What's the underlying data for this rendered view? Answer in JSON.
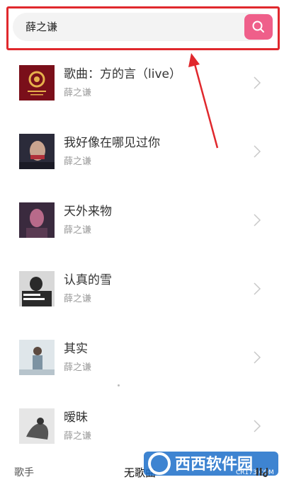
{
  "search": {
    "query": "薛之谦",
    "button_icon": "search-icon",
    "accent": "#ef5f8a"
  },
  "annotation": {
    "color": "#e0282d"
  },
  "songs": [
    {
      "title": "歌曲：方的言（live）",
      "artist": "薛之谦",
      "cover_colors": [
        "#7a0f1a",
        "#c8323a"
      ]
    },
    {
      "title": "我好像在哪见过你",
      "artist": "薛之谦",
      "cover_colors": [
        "#2b2b3a",
        "#b0303a"
      ]
    },
    {
      "title": "天外来物",
      "artist": "薛之谦",
      "cover_colors": [
        "#3a2a3e",
        "#b86a8a"
      ]
    },
    {
      "title": "认真的雪",
      "artist": "薛之谦",
      "cover_colors": [
        "#d8d8d8",
        "#2a2a2a"
      ]
    },
    {
      "title": "其实",
      "artist": "薛之谦",
      "cover_colors": [
        "#dfe6ea",
        "#7d93a3"
      ]
    },
    {
      "title": "暧昧",
      "artist": "薛之谦",
      "cover_colors": [
        "#e6e6e6",
        "#555555"
      ]
    }
  ],
  "bottom": {
    "singer_tab": "歌手",
    "no_song": "无歌曲"
  },
  "watermark": {
    "text": "西西软件园",
    "sub": "CR173.COM"
  }
}
